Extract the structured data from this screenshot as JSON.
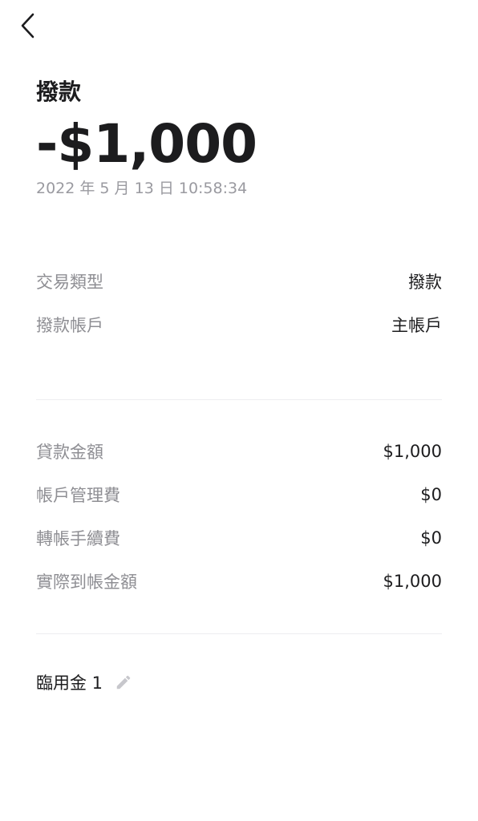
{
  "nav": {
    "back_icon": "chevron-left-icon"
  },
  "transaction": {
    "title": "撥款",
    "amount": "-$1,000",
    "datetime": "2022 年 5 月 13 日 10:58:34"
  },
  "details": [
    {
      "label": "交易類型",
      "value": "撥款"
    },
    {
      "label": "撥款帳戶",
      "value": "主帳戶"
    }
  ],
  "breakdown": [
    {
      "label": "貸款金額",
      "value": "$1,000"
    },
    {
      "label": "帳戶管理費",
      "value": "$0"
    },
    {
      "label": "轉帳手續費",
      "value": "$0"
    },
    {
      "label": "實際到帳金額",
      "value": "$1,000"
    }
  ],
  "note": {
    "text": "臨用金 1",
    "edit_icon": "pencil-icon"
  },
  "colors": {
    "primary_text": "#1c1c1e",
    "secondary_text": "#8e8e93",
    "divider": "#ededf0",
    "icon_gray": "#c7c7cc"
  }
}
